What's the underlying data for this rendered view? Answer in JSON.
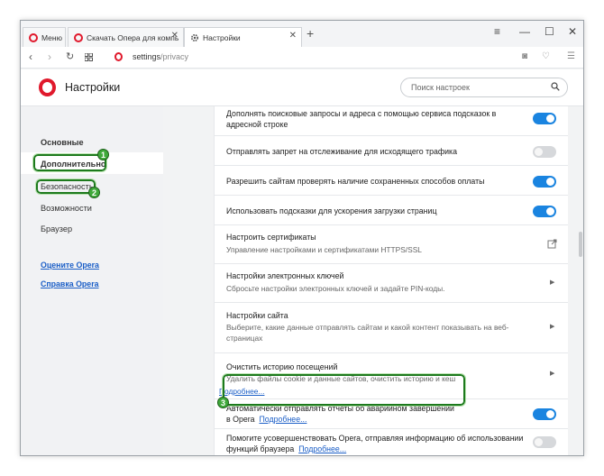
{
  "tabs": [
    {
      "label": "Меню",
      "active": false
    },
    {
      "label": "Скачать Опера для компь",
      "active": false
    },
    {
      "label": "Настройки",
      "active": true
    }
  ],
  "address": {
    "host": "settings",
    "path": "/privacy"
  },
  "header": {
    "title": "Настройки",
    "search_placeholder": "Поиск настроек"
  },
  "sidebar": {
    "items": [
      "Основные",
      "Дополнительно",
      "Безопасность",
      "Возможности",
      "Браузер"
    ],
    "links": [
      "Оцените Opera",
      "Справка Opera"
    ]
  },
  "content": {
    "rows": [
      {
        "title": "Дополнять поисковые запросы и адреса с помощью сервиса подсказок в адресной строке",
        "control": "toggle",
        "on": true
      },
      {
        "title": "Отправлять запрет на отслеживание для исходящего трафика",
        "control": "toggle",
        "on": false
      },
      {
        "title": "Разрешить сайтам проверять наличие сохраненных способов оплаты",
        "control": "toggle",
        "on": true
      },
      {
        "title": "Использовать подсказки для ускорения загрузки страниц",
        "control": "toggle",
        "on": true
      },
      {
        "title": "Настроить сертификаты",
        "subtitle": "Управление настройками и сертификатами HTTPS/SSL",
        "control": "external"
      },
      {
        "title": "Настройки электронных ключей",
        "subtitle": "Сбросьте настройки электронных ключей и задайте PIN-коды.",
        "control": "arrow"
      },
      {
        "title": "Настройки сайта",
        "subtitle": "Выберите, какие данные отправлять сайтам и какой контент показывать на веб-страницах",
        "control": "arrow"
      },
      {
        "title": "Очистить историю посещений",
        "subtitle": "Удалить файлы cookie и данные сайтов, очистить историю и кеш",
        "control": "arrow"
      }
    ],
    "more_link": "Подробнее...",
    "crash_reports": {
      "title": "Автоматически отправлять отчеты об аварийном завершении в Opera",
      "link": "Подробнее...",
      "on": true
    },
    "improve": {
      "title": "Помогите усовершенствовать Opera, отправляя информацию об использовании функций браузера",
      "link": "Подробнее...",
      "on": false
    }
  },
  "annotations": [
    "1",
    "2",
    "3"
  ],
  "colors": {
    "accent": "#1a84e0",
    "opera_red": "#e0192c",
    "highlight_green": "#1d7a1d"
  },
  "icons": [
    "opera-icon",
    "settings-gear-icon",
    "close-icon",
    "plus-icon",
    "back-icon",
    "forward-icon",
    "reload-icon",
    "grid-icon",
    "camera-icon",
    "heart-icon",
    "menu-icon",
    "search-icon",
    "external-link-icon",
    "chevron-right-icon"
  ]
}
